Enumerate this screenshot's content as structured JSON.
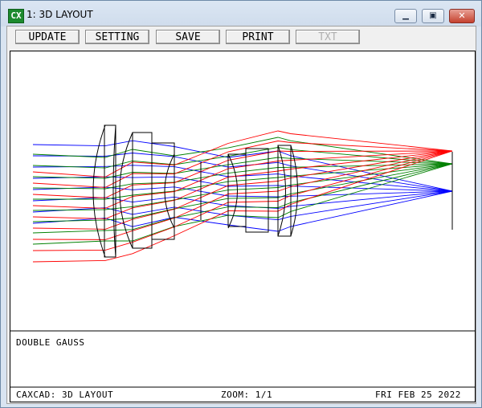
{
  "window": {
    "icon_text": "CX",
    "title": "1: 3D LAYOUT"
  },
  "toolbar": {
    "update": "UPDATE",
    "setting": "SETTING",
    "save": "SAVE",
    "print": "PRINT",
    "txt": "TXT"
  },
  "caption": "DOUBLE GAUSS",
  "status": {
    "left": "CAXCAD: 3D LAYOUT",
    "zoom": "ZOOM: 1/1",
    "date": "FRI FEB 25 2022"
  },
  "colors": {
    "field1": "#0000ff",
    "field2": "#008000",
    "field3": "#ff0000",
    "lens": "#000000"
  }
}
